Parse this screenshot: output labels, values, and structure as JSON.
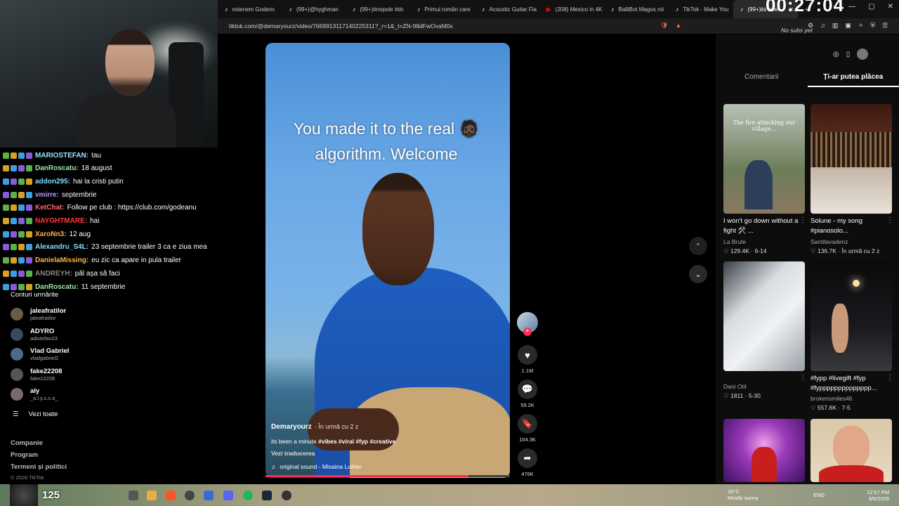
{
  "browser": {
    "tabs": [
      {
        "label": "nstenem Godenc",
        "icon": "tiktok-icon"
      },
      {
        "label": "(99+)@hyghman",
        "icon": "tiktok-icon"
      },
      {
        "label": "(99+)#nopole #dc",
        "icon": "tiktok-icon"
      },
      {
        "label": "Primul român care",
        "icon": "tiktok-icon"
      },
      {
        "label": "Acoustic Guitar Fla",
        "icon": "tiktok-icon"
      },
      {
        "label": "(208) Mexico in 4K",
        "icon": "youtube-icon"
      },
      {
        "label": "BalliBot Magos rol",
        "icon": "tiktok-icon"
      },
      {
        "label": "TikTok - Make You",
        "icon": "tiktok-icon"
      },
      {
        "label": "(99+)its been",
        "icon": "tiktok-icon",
        "active": true
      }
    ],
    "url": "tiktok.com/@demaryourz/video/7669913117140225311?_r=1&_t=ZN-98dFwOvaM0x"
  },
  "overlay": {
    "timer": "00:27:04",
    "no_subs": "No subs yet"
  },
  "chat": [
    {
      "user": "MARIOSTEFAN:",
      "text": "tau",
      "color": "#9ae6ff"
    },
    {
      "user": "DanRoscatu:",
      "text": "18 august",
      "color": "#9ee6a8"
    },
    {
      "user": "addon295:",
      "text": "hai la cristi putin",
      "color": "#7fe0ff"
    },
    {
      "user": "vmirre:",
      "text": "septembrie",
      "color": "#b89cff"
    },
    {
      "user": "KetChat:",
      "text": "Follow pe club : https://club.com/godeanu",
      "color": "#ff6b6b"
    },
    {
      "user": "NAYGHTMARE:",
      "text": "hai",
      "color": "#ff3b3b"
    },
    {
      "user": "XaroNn3:",
      "text": "12 aug",
      "color": "#ffb347"
    },
    {
      "user": "Alexandru_S4L:",
      "text": "23 septembrie trailer 3 ca e ziua mea",
      "color": "#7fe0ff"
    },
    {
      "user": "DanielaMissing:",
      "text": "eu zic ca apare in pula trailer",
      "color": "#ffb347"
    },
    {
      "user": "ANDREYH:",
      "text": "păl așa să faci",
      "color": "#888888"
    },
    {
      "user": "DanRoscatu:",
      "text": "11 septembrie",
      "color": "#9ee6a8"
    }
  ],
  "sidebar": {
    "following_heading": "Conturi urmărite",
    "accounts": [
      {
        "name": "jaleafratilor",
        "handle": "jaleafratilor"
      },
      {
        "name": "ADYRO",
        "handle": "adistefan23"
      },
      {
        "name": "Vlad Gabriel",
        "handle": "vladgabriel2"
      },
      {
        "name": "fake22208",
        "handle": "fake22208"
      },
      {
        "name": "aly",
        "handle": "_a.l.y.s.s.a_"
      }
    ],
    "see_all": "Vezi toate",
    "footer_links": [
      "Companie",
      "Program",
      "Termeni și politici"
    ],
    "copyright": "© 2026 TikTok"
  },
  "video": {
    "caption_line1": "You made it to the real 🧔🏿",
    "caption_line2": "algorithm. Welcome",
    "author": "Demaryourz",
    "time": "· În urmă cu 2 z",
    "desc_prefix": "its been a minute",
    "hashtags": "#vibes #viral #fyp #creative",
    "translate": "Vezi traducerea",
    "sound": "original sound - Misaina Luther",
    "progress": 0.83
  },
  "actions": {
    "likes": "1.1M",
    "comments": "59.2K",
    "saves": "104.3K",
    "shares": "476K"
  },
  "right_panel": {
    "tabs": [
      "Comentarii",
      "Ți-ar putea plăcea"
    ],
    "items": [
      {
        "title": "I won't go down without a fight 🛠️ ...",
        "author": "La Brute",
        "stats": "♡ 129.4K · 6-14",
        "overlay": "The fire attacking our village..."
      },
      {
        "title": "Solune - my song #pianosolo...",
        "author": "Santilavadenz",
        "stats": "♡ 136.7K · În urmă cu 2 z"
      },
      {
        "title": "",
        "author": "Dani Otil",
        "stats": "♡ 1811 · 5-30"
      },
      {
        "title": "#fypp #livegift #fyp #fypppppppppppppp...",
        "author": "brokensmiles46",
        "stats": "♡ 557.6K · 7-5"
      }
    ]
  },
  "taskbar": {
    "viewers": "125",
    "weather_temp": "33°C",
    "weather_desc": "Mostly sunny",
    "lang": "ENG",
    "time": "12:57 PM",
    "date": "8/6/2026"
  }
}
